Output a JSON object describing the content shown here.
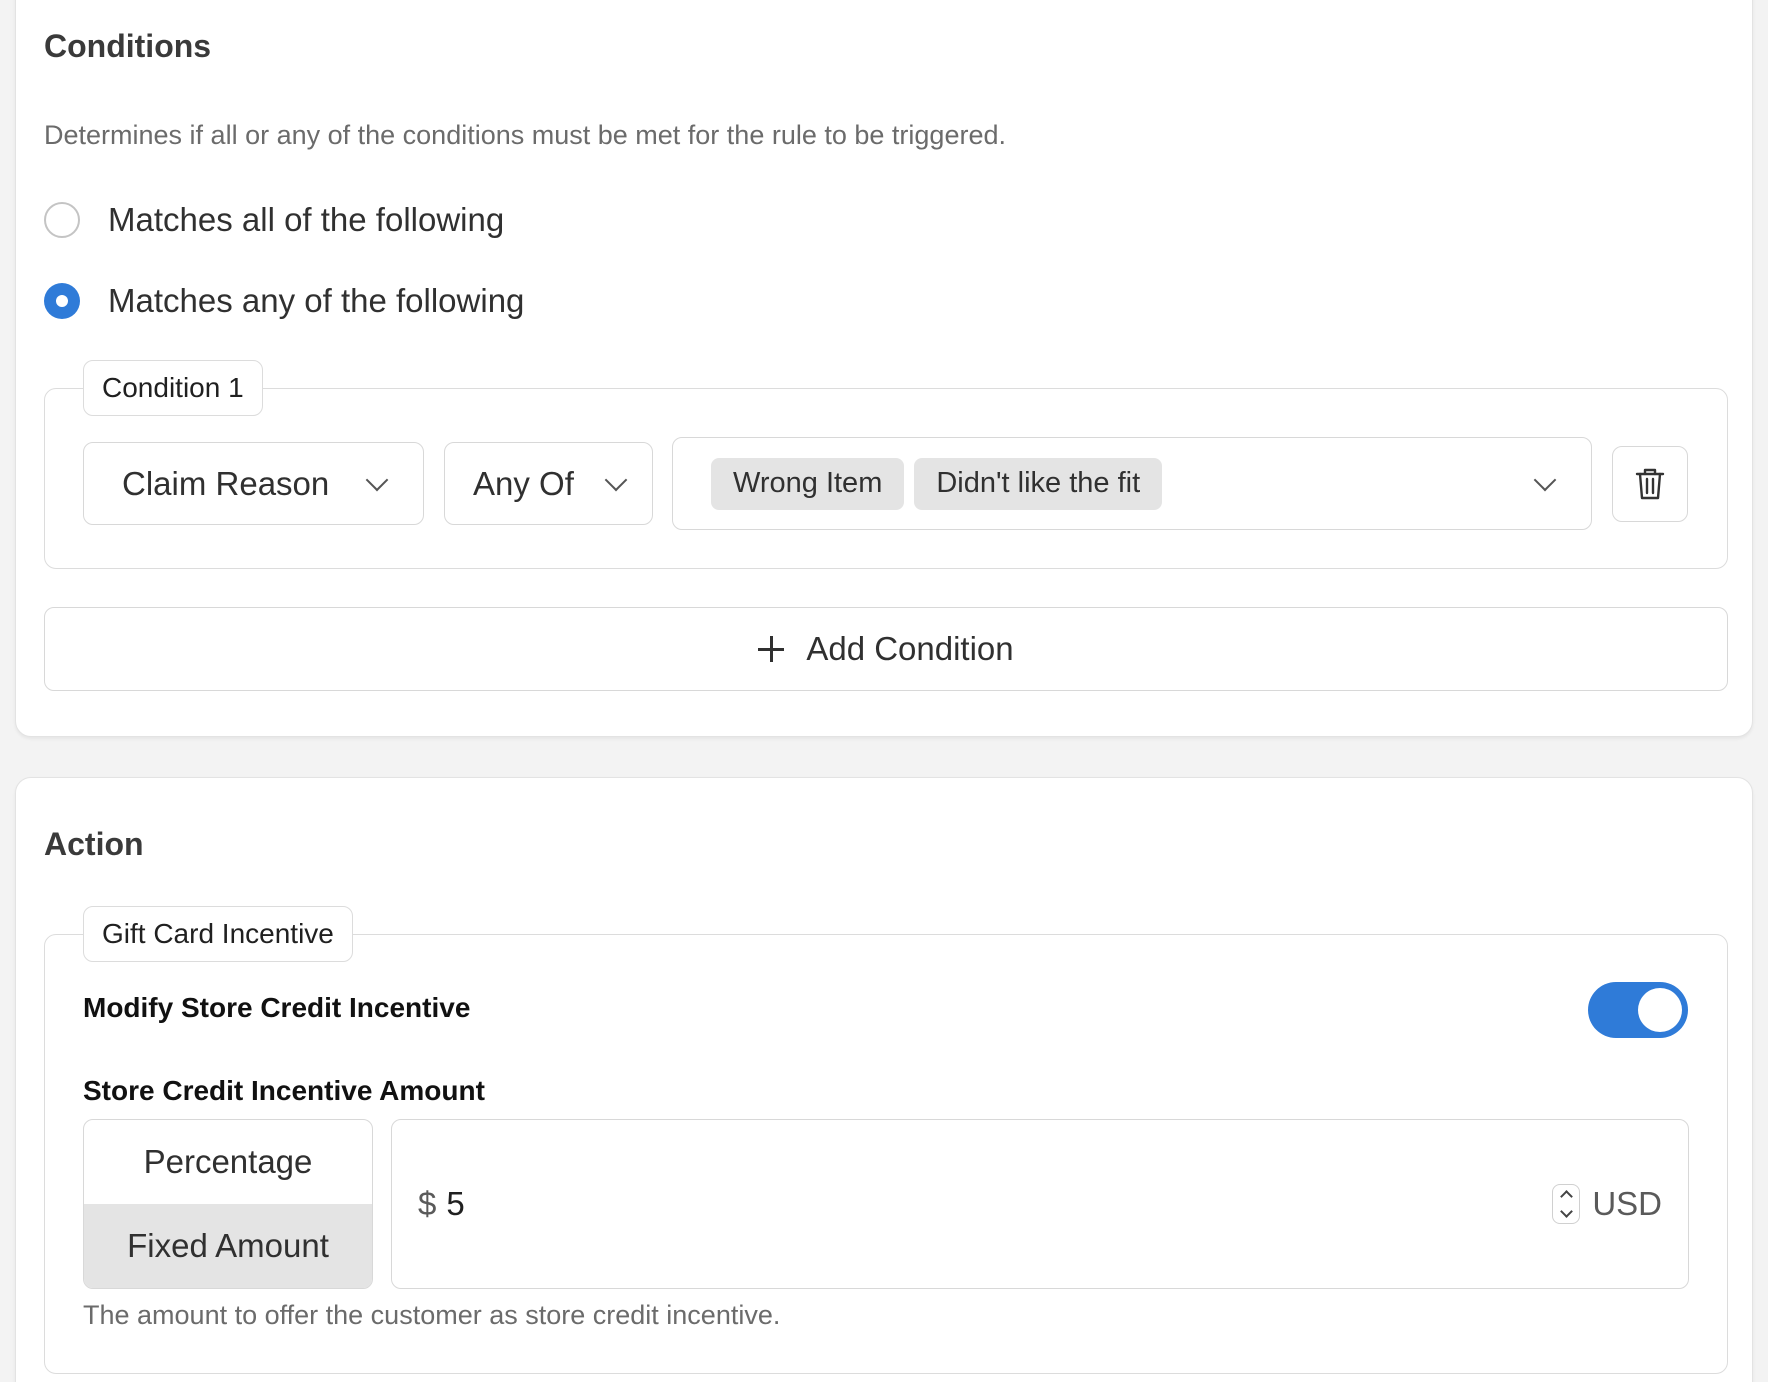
{
  "conditions": {
    "title": "Conditions",
    "description": "Determines if all or any of the conditions must be met for the rule to be triggered.",
    "match_options": [
      {
        "label": "Matches all of the following",
        "selected": false
      },
      {
        "label": "Matches any of the following",
        "selected": true
      }
    ],
    "condition_1": {
      "legend": "Condition 1",
      "field": "Claim Reason",
      "operator": "Any Of",
      "values": [
        "Wrong Item",
        "Didn't like the fit"
      ]
    },
    "add_condition_label": "Add Condition"
  },
  "action": {
    "title": "Action",
    "legend": "Gift Card Incentive",
    "modify_label": "Modify Store Credit Incentive",
    "modify_enabled": true,
    "amount_label": "Store Credit Incentive Amount",
    "amount_types": [
      {
        "label": "Percentage",
        "selected": false
      },
      {
        "label": "Fixed Amount",
        "selected": true
      }
    ],
    "currency_symbol": "$",
    "amount_value": "5",
    "currency_code": "USD",
    "help_text": "The amount to offer the customer as store credit incentive."
  },
  "colors": {
    "accent": "#2f7bd8",
    "chip_bg": "#e4e4e4",
    "page_bg": "#f3f3f3"
  }
}
